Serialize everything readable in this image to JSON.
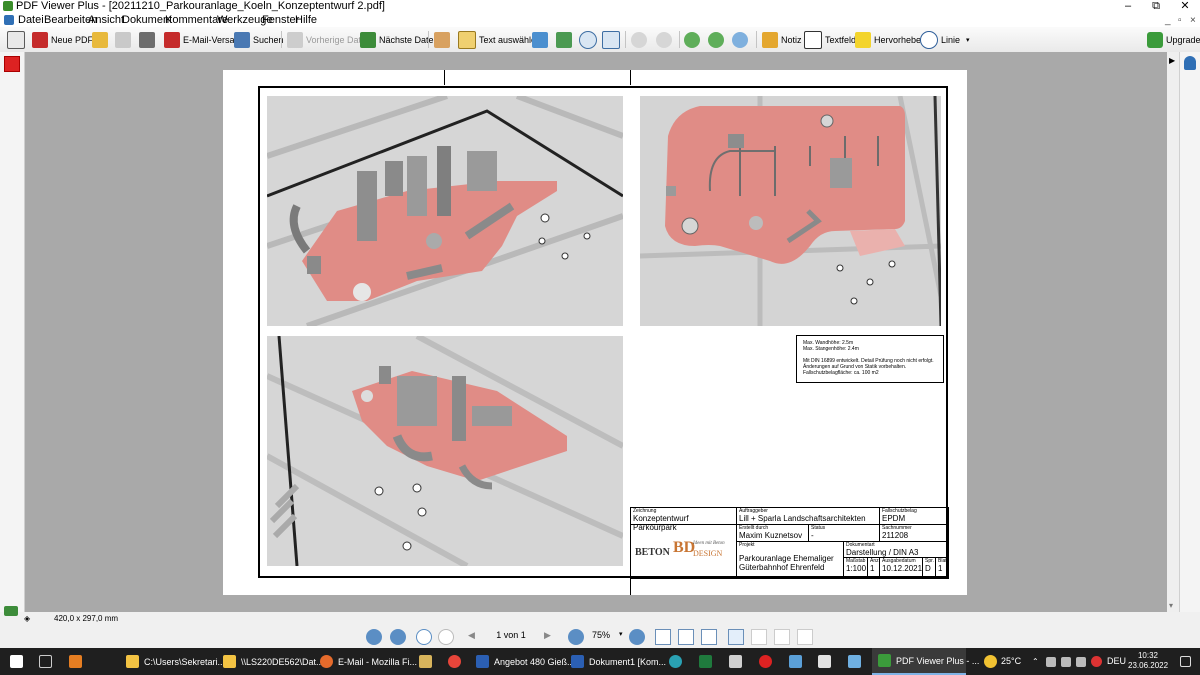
{
  "window": {
    "title": "PDF Viewer Plus - [20211210_Parkouranlage_Koeln_Konzeptentwurf 2.pdf]",
    "minimize": "–",
    "maximize": "⧉",
    "close": "✕"
  },
  "menu": [
    "Datei",
    "Bearbeiten",
    "Ansicht",
    "Dokument",
    "Kommentare",
    "Werkzeuge",
    "Fenster",
    "Hilfe"
  ],
  "toolbar": {
    "new_pdf": "Neue PDF",
    "email": "E-Mail-Versand",
    "search": "Suchen",
    "prev_file": "Vorherige Datei",
    "next_file": "Nächste Datei",
    "select_text": "Text auswählen",
    "note": "Notiz",
    "textfield": "Textfeld",
    "highlight": "Hervorheben",
    "line": "Linie",
    "upgrade": "Upgrade"
  },
  "drawing": {
    "notes": [
      "Max. Wandhöhe: 2.5m",
      "Max. Stangenhöhe: 2.4m",
      "",
      "Mit DIN 16899 entwickelt. Detail Prüfung noch nicht erfolgt.",
      "Änderungen auf Grund von Statik vorbehalten.",
      "Fallschutzbelagfläche: ca. 100 m2"
    ],
    "title_block": {
      "zeichnung_label": "Zeichnung",
      "zeichnung": "Konzeptentwurf Parkourpark",
      "auftraggeber_label": "Auftraggeber",
      "auftraggeber": "Lill + Sparla Landschaftsarchitekten",
      "fallschutz_label": "Fallschutzbelag",
      "fallschutz": "EPDM",
      "erstellt_label": "Erstellt durch",
      "erstellt": "Maxim Kuznetsov",
      "status_label": "Status",
      "status": "-",
      "sachnummer_label": "Sachnummer",
      "sachnummer": "211208",
      "projekt_label": "Projekt",
      "projekt_1": "Parkouranlage Ehemaliger",
      "projekt_2": "Güterbahnhof Ehrenfeld",
      "dokumentart_label": "Dokumentart",
      "dokumentart": "Darstellung / DIN A3",
      "massstab_label": "Maßstab",
      "massstab": "1:100",
      "anz_label": "Anz.",
      "anz": "1",
      "ausgabe_label": "Ausgabedatum",
      "ausgabe": "10.12.2021",
      "spr_label": "Spr.",
      "spr": "D",
      "blatt_label": "Blatt",
      "blatt": "1",
      "logo_text": "BETON",
      "logo_design": "DESIGN",
      "logo_script": "Ideen mit Beton"
    }
  },
  "status": {
    "page_size": "420,0 x 297,0 mm"
  },
  "nav": {
    "page": "1 von 1",
    "zoom": "75%"
  },
  "taskbar": {
    "items": [
      "C:\\Users\\Sekretari...",
      "\\\\LS220DE562\\Dat...",
      "E-Mail - Mozilla Fi...",
      "Angebot 480 Gieß...",
      "Dokument1 [Kom...",
      "PDF Viewer Plus - ..."
    ],
    "temp": "25°C",
    "lang": "DEU",
    "time": "10:32",
    "date": "23.06.2022"
  },
  "colors": {
    "accent": "#2f6fb5",
    "pad": "#e08c86",
    "taskbar": "#1f1f1f"
  }
}
